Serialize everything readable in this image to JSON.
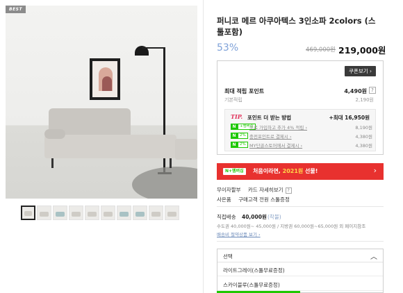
{
  "gallery": {
    "badge": "BEST",
    "thumbnails": [
      "sofa-gray-1",
      "sofa-gray-2",
      "sofa-blue-1",
      "sofa-gray-3",
      "sofa-gray-4",
      "sofa-gray-5",
      "sofa-blue-2",
      "sofa-blue-3",
      "sofa-gray-6",
      "sofa-gray-7"
    ],
    "active_index": 0
  },
  "product": {
    "title": "퍼니코 메르 아쿠아텍스 3인소파 2colors (스툴포함)",
    "discount": "53%",
    "original_price": "469,000원",
    "sale_price": "219,000원"
  },
  "points": {
    "coupon_button": "쿠폰보기 ›",
    "max_label": "최대 적립 포인트",
    "max_value": "4,490원",
    "help_icon": "?",
    "base_label": "기본적립",
    "base_value": "2,190원",
    "tip": {
      "tag": "TIP.",
      "title": "포인트 더 받는 방법",
      "max": "+최대 16,950원",
      "rows": [
        {
          "badge": "N",
          "badge2": "+멤버십",
          "text": "무료 가입하고 추가 4% 적립 ›",
          "amount": "8,190원"
        },
        {
          "badge": "N",
          "badge2": "2%",
          "text": "충전포인트로 결제시 ›",
          "amount": "4,380원"
        },
        {
          "badge": "N",
          "badge2": "2%",
          "text": "MY단골스토어에서 결제시 ›",
          "amount": "4,380원"
        }
      ]
    }
  },
  "first_banner": {
    "badge": "N+멤버십",
    "text_before": "처음이라면, ",
    "highlight": "2021원",
    "text_after": " 선물!",
    "chevron": "›"
  },
  "options": {
    "installment": "무이자할부",
    "installment_detail": "카드 자세히보기",
    "installment_help": "?",
    "gift_label": "사은품",
    "gift_text": "구매고객 전원 스툴증정"
  },
  "shipping": {
    "label": "직접배송",
    "value": "40,000원",
    "note": "(착불)",
    "detail": "수도권 40,000원~ 45,000원 / 지방권 60,000원~65,000원 외 페이지참조",
    "link": "배송비 절약상품 보기 ›"
  },
  "select": {
    "placeholder": "선택",
    "chevron": "︿",
    "options": [
      "라이트그레이(스툴무료증정)",
      "스카이블루(스툴무료증정)"
    ]
  },
  "colors": {
    "discount": "#7ea1d8",
    "banner": "#e8312f",
    "naver_green": "#1ec800",
    "tip_red": "#e0325b"
  }
}
